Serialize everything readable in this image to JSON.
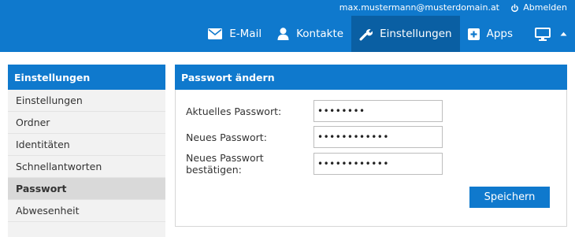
{
  "header": {
    "user_email": "max.mustermann@musterdomain.at",
    "logout_label": "Abmelden",
    "nav": [
      {
        "label": "E-Mail",
        "icon": "envelope-icon"
      },
      {
        "label": "Kontakte",
        "icon": "person-icon"
      },
      {
        "label": "Einstellungen",
        "icon": "wrench-icon",
        "active": true
      },
      {
        "label": "Apps",
        "icon": "plus-square-icon"
      }
    ],
    "device_icon": "monitor-icon",
    "collapse_icon": "caret-up-icon"
  },
  "sidebar": {
    "title": "Einstellungen",
    "items": [
      {
        "label": "Einstellungen"
      },
      {
        "label": "Ordner"
      },
      {
        "label": "Identitäten"
      },
      {
        "label": "Schnellantworten"
      },
      {
        "label": "Passwort",
        "active": true
      },
      {
        "label": "Abwesenheit"
      }
    ]
  },
  "main": {
    "title": "Passwort ändern",
    "fields": [
      {
        "label": "Aktuelles Passwort:",
        "value": "••••••••"
      },
      {
        "label": "Neues Passwort:",
        "value": "••••••••••••"
      },
      {
        "label": "Neues Passwort bestätigen:",
        "value": "••••••••••••"
      }
    ],
    "save_label": "Speichern"
  },
  "colors": {
    "accent": "#0f79cd",
    "accent_dark": "#0a5fa3",
    "sidebar_bg": "#f2f2f2",
    "sidebar_active": "#d9d9d9"
  }
}
